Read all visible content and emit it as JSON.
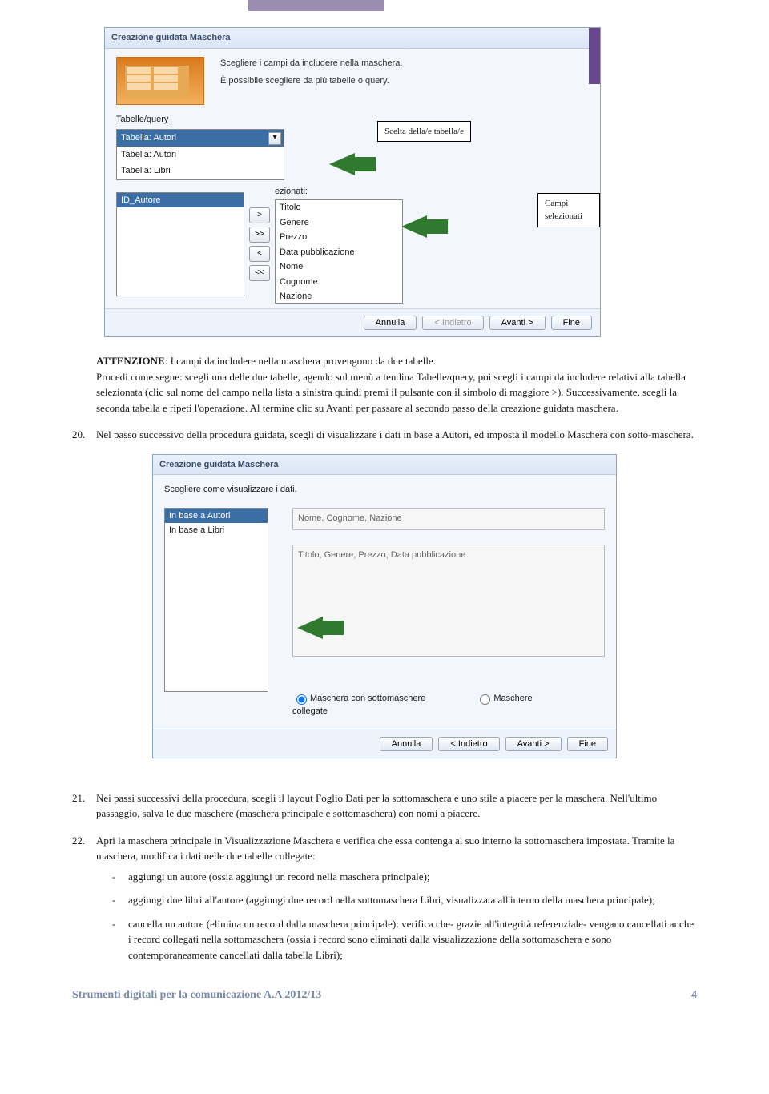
{
  "wizard1": {
    "title": "Creazione guidata Maschera",
    "desc1": "Scegliere i campi da includere nella maschera.",
    "desc2": "È possibile scegliere da più tabelle o query.",
    "tq_label": "Tabelle/query",
    "select_options": [
      "Tabella: Autori",
      "Tabella: Autori",
      "Tabella: Libri"
    ],
    "selected_suffix": "ezionati:",
    "available_header": "ID_Autore",
    "btn_add": ">",
    "btn_addall": ">>",
    "btn_remove": "<",
    "btn_removeall": "<<",
    "selected_fields": [
      "Titolo",
      "Genere",
      "Prezzo",
      "Data pubblicazione",
      "Nome",
      "Cognome",
      "Nazione"
    ],
    "footer": {
      "cancel": "Annulla",
      "back": "< Indietro",
      "next": "Avanti >",
      "finish": "Fine"
    }
  },
  "callouts": {
    "c1": "Scelta della/e tabella/e",
    "c2": "Campi selezionati"
  },
  "para_attn_lead": "ATTENZIONE",
  "para_attn": ": I campi da includere nella maschera provengono da due tabelle.",
  "para19": "Procedi come segue: scegli una delle due tabelle, agendo sul menù a tendina Tabelle/query, poi scegli i campi da includere relativi alla tabella selezionata (clic sul nome del campo nella lista a sinistra quindi premi il pulsante con il simbolo di maggiore >). Successivamente, scegli la seconda tabella e ripeti l'operazione. Al termine clic su Avanti per passare al secondo passo della creazione guidata maschera.",
  "para20_num": "20.",
  "para20": "Nel passo successivo della procedura guidata, scegli di visualizzare i dati in base a Autori, ed imposta il modello Maschera con sotto-maschera.",
  "wizard2": {
    "title": "Creazione guidata Maschera",
    "instr": "Scegliere come visualizzare i dati.",
    "options": [
      "In base a Autori",
      "In base a Libri"
    ],
    "ro1": "Nome, Cognome, Nazione",
    "ro2": "Titolo, Genere, Prezzo, Data pubblicazione",
    "radio1": "Maschera con sottomaschere",
    "radio2": "Maschere collegate",
    "footer": {
      "cancel": "Annulla",
      "back": "< Indietro",
      "next": "Avanti >",
      "finish": "Fine"
    }
  },
  "para21_num": "21.",
  "para21": "Nei passi successivi della procedura, scegli il layout Foglio Dati per la sottomaschera e uno stile a piacere per la maschera. Nell'ultimo passaggio, salva le due maschere (maschera principale e sottomaschera) con nomi a piacere.",
  "para22_num": "22.",
  "para22": "Apri la maschera principale in Visualizzazione Maschera e verifica che essa contenga al suo interno la sottomaschera impostata. Tramite la maschera, modifica i dati nelle due tabelle collegate:",
  "bullets": [
    "aggiungi un autore (ossia aggiungi un record nella maschera principale);",
    "aggiungi due libri all'autore (aggiungi due record nella sottomaschera Libri, visualizzata all'interno della maschera principale);",
    "cancella un autore (elimina un record dalla maschera principale): verifica che- grazie all'integrità referenziale- vengano cancellati anche i record collegati nella sottomaschera (ossia i record sono eliminati dalla visualizzazione della sottomaschera e sono contemporaneamente cancellati dalla tabella Libri);"
  ],
  "footer": {
    "title": "Strumenti digitali per la comunicazione A.A 2012/13",
    "page": "4"
  }
}
